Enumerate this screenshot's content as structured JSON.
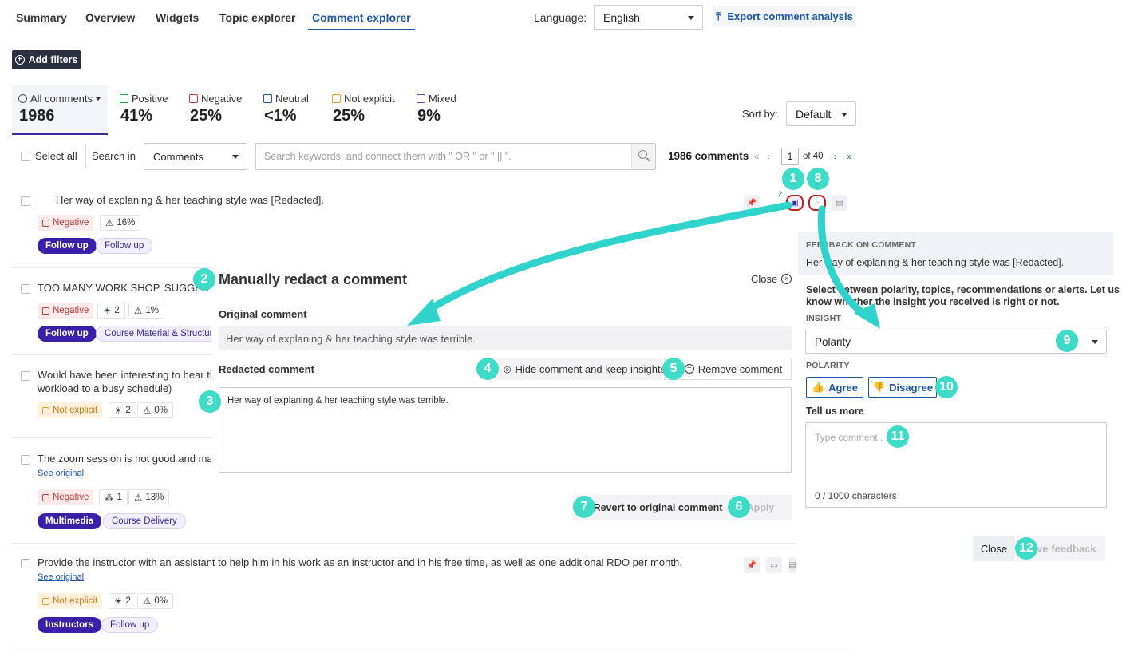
{
  "nav": {
    "tabs": [
      "Summary",
      "Overview",
      "Widgets",
      "Topic explorer",
      "Comment explorer"
    ],
    "language_label": "Language:",
    "language_value": "English",
    "export_label": "Export comment analysis"
  },
  "filters": {
    "add_label": "Add filters"
  },
  "stats": [
    {
      "label": "All comments",
      "value": "1986"
    },
    {
      "label": "Positive",
      "value": "41%"
    },
    {
      "label": "Negative",
      "value": "25%"
    },
    {
      "label": "Neutral",
      "value": "<1%"
    },
    {
      "label": "Not explicit",
      "value": "25%"
    },
    {
      "label": "Mixed",
      "value": "9%"
    }
  ],
  "sort": {
    "label": "Sort by:",
    "value": "Default"
  },
  "toolbar": {
    "select_all": "Select all",
    "search_in": "Search in",
    "search_in_value": "Comments",
    "search_placeholder": "Search keywords, and connect them with \" OR \" or \" || \".",
    "count": "1986 comments",
    "page": "1",
    "of": "of 40"
  },
  "comments": [
    {
      "text": "Her way of explaning & her teaching style was [Redacted].",
      "sentiment": "Negative",
      "alert": "16%",
      "tags": [
        "Follow up",
        "Follow up"
      ]
    },
    {
      "text": "TOO MANY WORK SHOP, SUGGES",
      "sentiment": "Negative",
      "reco": "2",
      "alert": "1%",
      "tags": [
        "Follow up",
        "Course Material & Structur"
      ]
    },
    {
      "text": "Would have been interesting to hear the",
      "text2": "workload to a busy schedule)",
      "sentiment": "Not explicit",
      "reco": "2",
      "alert": "0%"
    },
    {
      "text": "The zoom session is not good and makes",
      "see_original": "See original",
      "sentiment": "Negative",
      "topics": "1",
      "alert": "13%",
      "tags": [
        "Multimedia",
        "Course Delivery"
      ]
    },
    {
      "text": "Provide the instructor with an assistant to help him in his work as an instructor and in his free time, as well as one additional RDO per month.",
      "see_original": "See original",
      "sentiment": "Not explicit",
      "reco": "2",
      "alert": "0%",
      "tags": [
        "Instructors",
        "Follow up"
      ]
    }
  ],
  "icon_count": "2",
  "redact": {
    "title": "Manually redact a comment",
    "close": "Close",
    "original_label": "Original comment",
    "original_text": "Her way of explaning & her teaching style was terrible.",
    "redacted_label": "Redacted comment",
    "hide_label": "Hide comment and keep insights",
    "remove_label": "Remove comment",
    "redacted_text": "Her way of explaning & her teaching style was terrible.",
    "revert_label": "Revert to original comment",
    "apply_label": "Apply"
  },
  "feedback": {
    "header": "FEEDBACK ON COMMENT",
    "comment": "Her way of explaning & her teaching style was [Redacted].",
    "desc1": "Select between polarity, topics, recommendations or alerts. Let us",
    "desc2": "know whether the insight you received is right or not.",
    "insight_label": "INSIGHT",
    "insight_value": "Polarity",
    "polarity_label": "POLARITY",
    "agree": "Agree",
    "disagree": "Disagree",
    "tell_more": "Tell us more",
    "placeholder": "Type comment..",
    "counter": "0 / 1000 characters",
    "close": "Close",
    "give": "Give feedback"
  },
  "badges": [
    "1",
    "2",
    "3",
    "4",
    "5",
    "6",
    "7",
    "8",
    "9",
    "10",
    "11",
    "12"
  ],
  "colors": {
    "accent": "#1e56a8",
    "badge": "#3ddbc8",
    "tag": "#3a1fa8",
    "negative": "#c23a3a",
    "not_explicit": "#d27a10"
  }
}
